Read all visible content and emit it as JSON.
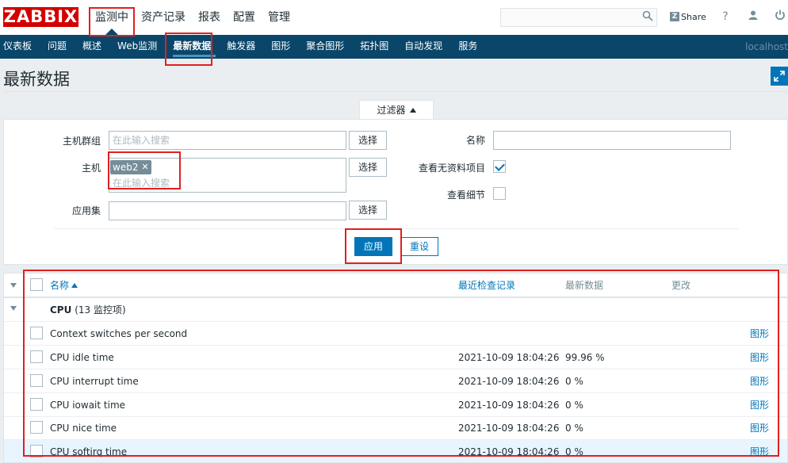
{
  "logo": "ZABBIX",
  "top_menu": [
    "监测中",
    "资产记录",
    "报表",
    "配置",
    "管理"
  ],
  "share_label": "Share",
  "help_icon": "?",
  "sub_menu": [
    "仪表板",
    "问题",
    "概述",
    "Web监测",
    "最新数据",
    "触发器",
    "图形",
    "聚合图形",
    "拓扑图",
    "自动发现",
    "服务"
  ],
  "server_name": "localhost",
  "page_title": "最新数据",
  "filter": {
    "tab_label": "过滤器",
    "host_group_label": "主机群组",
    "host_group_placeholder": "在此输入搜索",
    "host_label": "主机",
    "host_tag": "web2",
    "host_placeholder": "在此输入搜索",
    "application_label": "应用集",
    "select_label": "选择",
    "name_label": "名称",
    "show_without_data_label": "查看无资料项目",
    "show_without_data_checked": true,
    "show_details_label": "查看细节",
    "show_details_checked": false,
    "apply_label": "应用",
    "reset_label": "重设"
  },
  "table": {
    "columns": {
      "name": "名称",
      "last_check": "最近检查记录",
      "last_value": "最新数据",
      "change": "更改"
    },
    "group": {
      "name": "CPU",
      "count": "(13 监控项)"
    },
    "rows": [
      {
        "name": "Context switches per second",
        "last_check": "",
        "last_value": "",
        "link": "图形"
      },
      {
        "name": "CPU idle time",
        "last_check": "2021-10-09 18:04:26",
        "last_value": "99.96 %",
        "link": "图形"
      },
      {
        "name": "CPU interrupt time",
        "last_check": "2021-10-09 18:04:26",
        "last_value": "0 %",
        "link": "图形"
      },
      {
        "name": "CPU iowait time",
        "last_check": "2021-10-09 18:04:26",
        "last_value": "0 %",
        "link": "图形"
      },
      {
        "name": "CPU nice time",
        "last_check": "2021-10-09 18:04:26",
        "last_value": "0 %",
        "link": "图形"
      },
      {
        "name": "CPU softirq time",
        "last_check": "2021-10-09 18:04:26",
        "last_value": "0 %",
        "link": "图形"
      }
    ]
  }
}
